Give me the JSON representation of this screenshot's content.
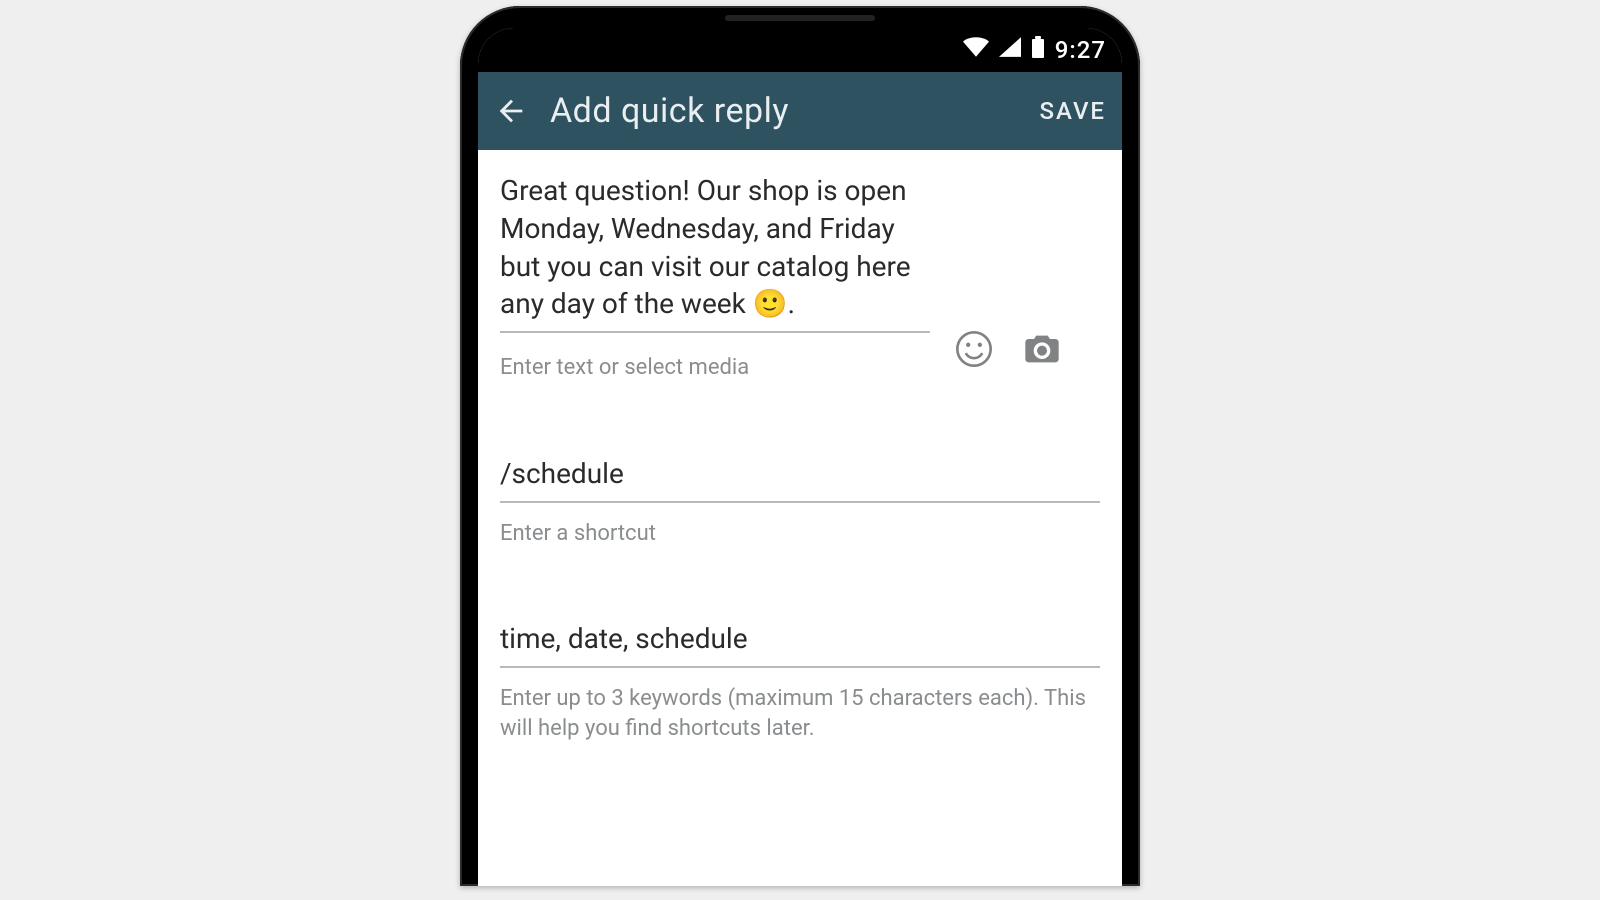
{
  "status": {
    "time": "9:27"
  },
  "appbar": {
    "title": "Add quick reply",
    "save_label": "SAVE"
  },
  "reply": {
    "value": "Great question! Our shop is open Monday, Wednesday, and Friday but you can visit our catalog here any day of the week 🙂.",
    "helper": "Enter text or select media"
  },
  "shortcut": {
    "value": "/schedule",
    "helper": "Enter a shortcut"
  },
  "keywords": {
    "value": "time, date, schedule",
    "helper": "Enter up to 3 keywords (maximum 15 characters each). This will help you find shortcuts later."
  }
}
